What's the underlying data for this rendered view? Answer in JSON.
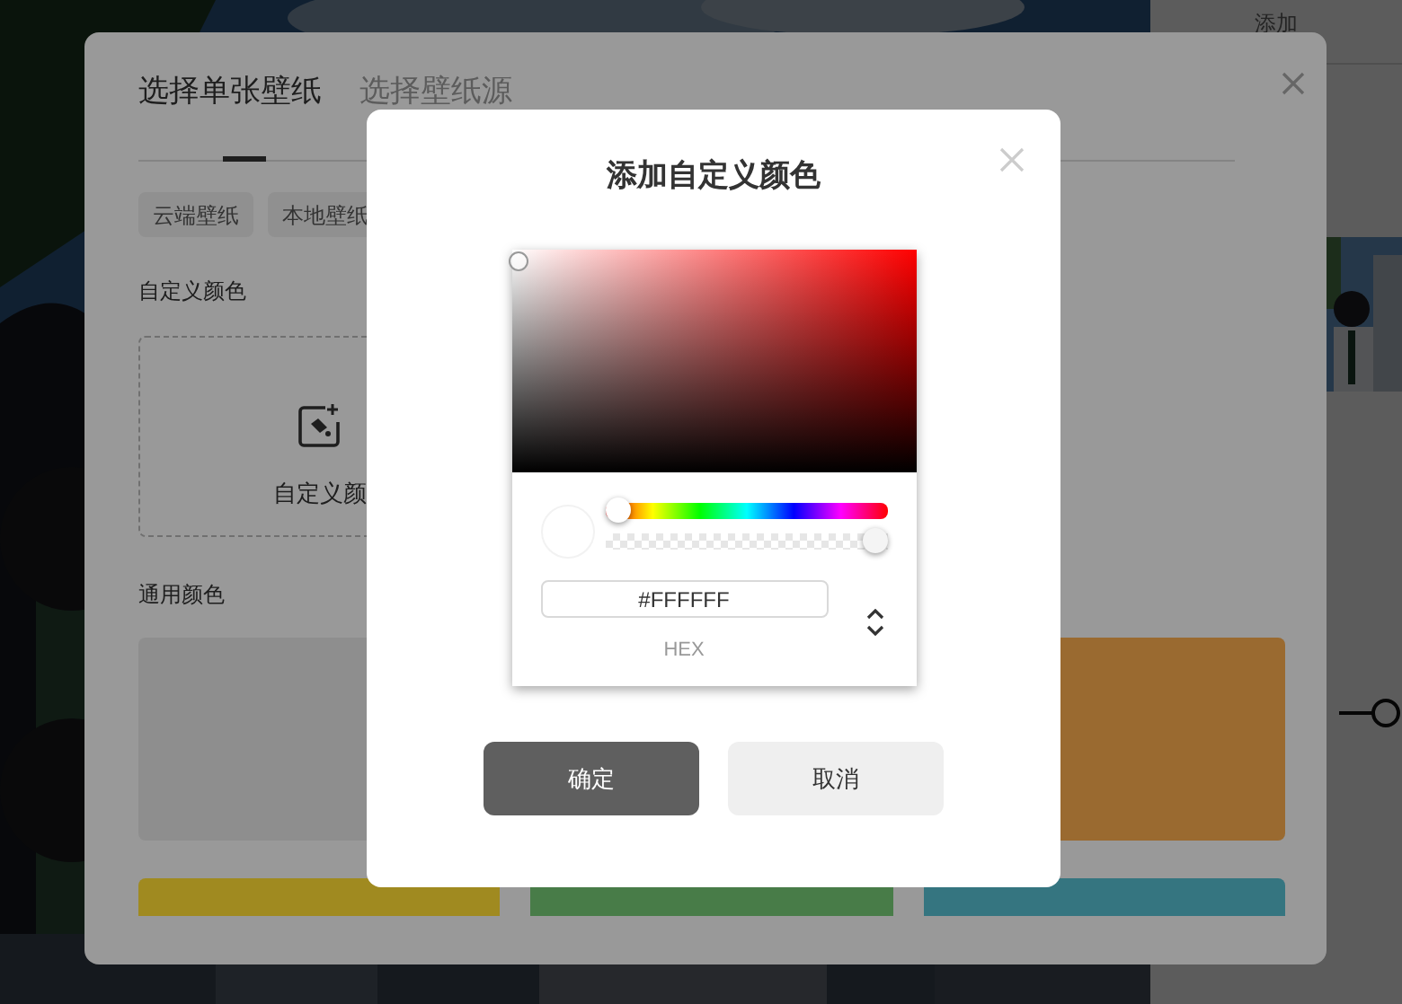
{
  "side_panel": {
    "header": "添加"
  },
  "dialog": {
    "tabs": [
      {
        "label": "选择单张壁纸",
        "selected": true
      },
      {
        "label": "选择壁纸源",
        "selected": false
      }
    ],
    "source_chips": [
      "云端壁纸",
      "本地壁纸"
    ],
    "custom_section": {
      "heading": "自定义颜色",
      "card_label": "自定义颜"
    },
    "common_section": {
      "heading": "通用颜色",
      "swatch_rows": [
        [
          {
            "color": "#8e8e8e"
          },
          {
            "color": "#9a6a30"
          }
        ],
        [
          {
            "color": "#a08a20"
          },
          {
            "color": "#487c48"
          },
          {
            "color": "#357580"
          }
        ]
      ]
    }
  },
  "color_modal": {
    "title": "添加自定义颜色",
    "picker": {
      "hue": {
        "level": 0
      },
      "alpha": {
        "level": 1
      },
      "hex_value": "#FFFFFF",
      "format_label": "HEX"
    },
    "buttons": [
      {
        "label": "确定",
        "kind": "primary"
      },
      {
        "label": "取消",
        "kind": "secondary"
      }
    ]
  }
}
